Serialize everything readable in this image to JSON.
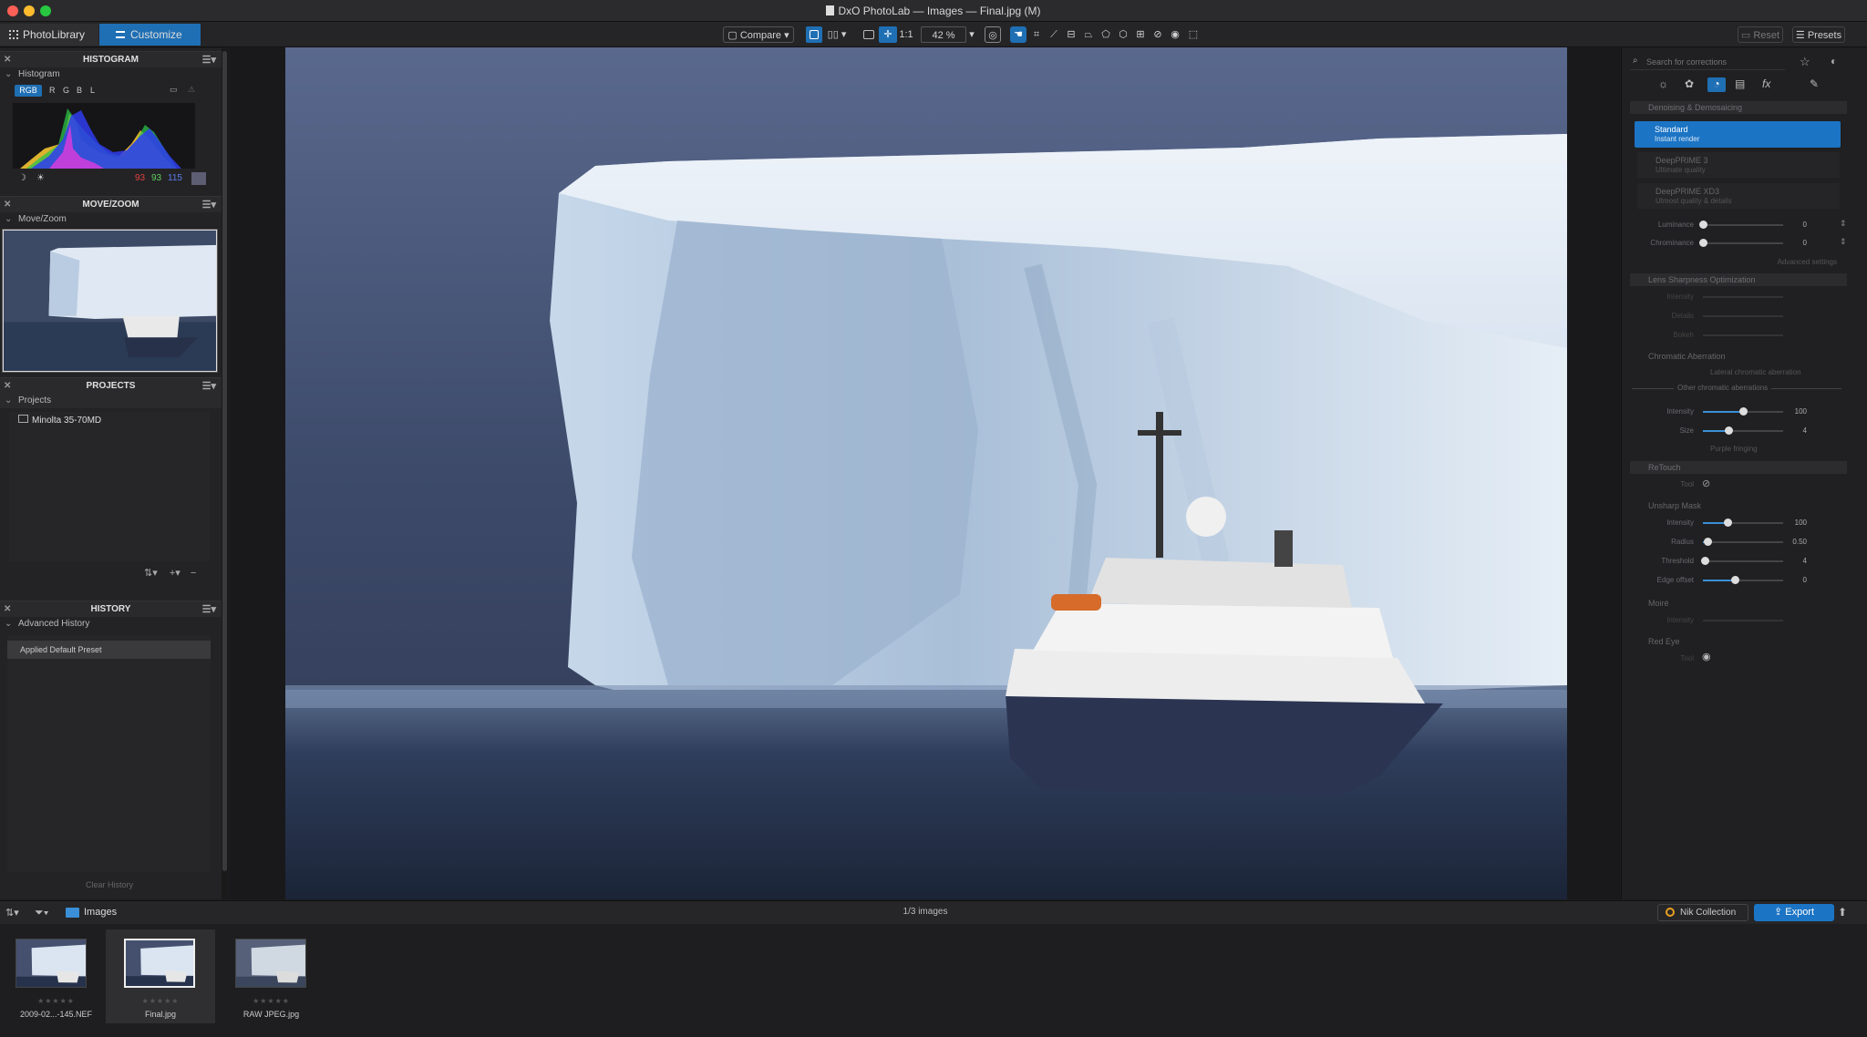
{
  "window": {
    "title": "DxO PhotoLab — Images — Final.jpg (M)"
  },
  "toolbar": {
    "tab_library": "PhotoLibrary",
    "tab_customize": "Customize",
    "compare": "Compare",
    "ratio": "1:1",
    "zoom": "42 %",
    "reset": "Reset",
    "presets": "Presets"
  },
  "histogram": {
    "title": "HISTOGRAM",
    "sub": "Histogram",
    "channels": [
      "RGB",
      "R",
      "G",
      "B",
      "L"
    ],
    "values": {
      "r": "93",
      "g": "93",
      "b": "115"
    }
  },
  "movezoom": {
    "title": "MOVE/ZOOM",
    "sub": "Move/Zoom"
  },
  "projects": {
    "title": "PROJECTS",
    "sub": "Projects",
    "item": "Minolta 35-70MD"
  },
  "history": {
    "title": "HISTORY",
    "sub": "Advanced History",
    "item": "Applied Default Preset",
    "clear": "Clear History"
  },
  "right": {
    "search_placeholder": "Search for corrections",
    "denoise_title": "Denoising & Demosaicing",
    "modes": [
      {
        "name": "Standard",
        "desc": "Instant render"
      },
      {
        "name": "DeepPRIME 3",
        "desc": "Ultimate quality"
      },
      {
        "name": "DeepPRIME XD3",
        "desc": "Utmost quality & details"
      }
    ],
    "luminance": "Luminance",
    "chrominance": "Chrominance",
    "lum_val": "0",
    "chr_val": "0",
    "advanced": "Advanced settings",
    "lso_title": "Lens Sharpness Optimization",
    "lso_intensity": "Intensity",
    "lso_details": "Details",
    "lso_bokeh": "Bokeh",
    "ca_title": "Chromatic Aberration",
    "ca_lateral": "Lateral chromatic aberration",
    "ca_other": "Other chromatic aberrations",
    "ca_intensity": "Intensity",
    "ca_intensity_val": "100",
    "ca_size": "Size",
    "ca_size_val": "4",
    "ca_purple": "Purple fringing",
    "retouch_title": "ReTouch",
    "retouch_tool": "Tool",
    "um_title": "Unsharp Mask",
    "um_intensity": "Intensity",
    "um_intensity_val": "100",
    "um_radius": "Radius",
    "um_radius_val": "0.50",
    "um_threshold": "Threshold",
    "um_threshold_val": "4",
    "um_edge": "Edge offset",
    "um_edge_val": "0",
    "moire_title": "Moiré",
    "moire_intensity": "Intensity",
    "redeye_title": "Red Eye",
    "redeye_tool": "Tool"
  },
  "bottom": {
    "folder": "Images",
    "count": "1/3 images",
    "nik": "Nik Collection",
    "export": "Export"
  },
  "thumbs": [
    {
      "name": "2009-02...-145.NEF"
    },
    {
      "name": "Final.jpg"
    },
    {
      "name": "RAW JPEG.jpg"
    }
  ],
  "levels": {
    "lum": 0.0,
    "chr": 0.0,
    "ca_intensity": 0.5,
    "ca_size": 0.32,
    "um_intensity": 0.31,
    "um_radius": 0.06,
    "um_threshold": 0.02,
    "um_edge": 0.4
  },
  "colors": {
    "accent": "#1f6fb4",
    "export": "#1c74c4"
  }
}
